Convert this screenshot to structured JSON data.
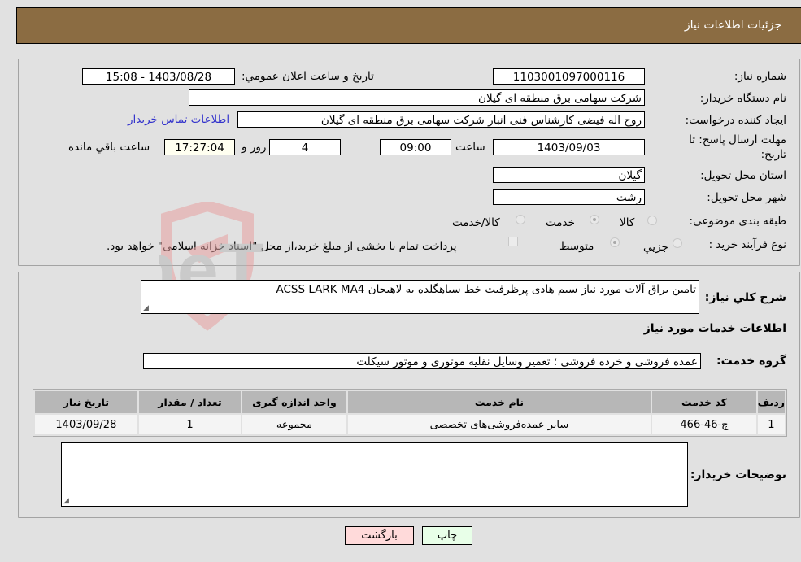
{
  "header": {
    "title": "جزئیات اطلاعات نیاز"
  },
  "form": {
    "need_number_label": "شماره نیاز:",
    "need_number": "1103001097000116",
    "announce_label": "تاریخ و ساعت اعلان عمومي:",
    "announce_value": "1403/08/28 - 15:08",
    "buyer_org_label": "نام دستگاه خریدار:",
    "buyer_org": "شرکت سهامی برق منطقه ای گیلان",
    "creator_label": "ایجاد کننده درخواست:",
    "creator": "روح اله فیضی کارشناس فنی انبار شرکت سهامی برق منطقه ای گیلان",
    "contact_link": "اطلاعات تماس خریدار",
    "deadline_label_1": "مهلت ارسال پاسخ: تا",
    "deadline_label_2": "تاریخ:",
    "deadline_date": "1403/09/03",
    "time_label": "ساعت",
    "deadline_time": "09:00",
    "days_value": "4",
    "days_label": "روز و",
    "remaining_time": "17:27:04",
    "remaining_label": "ساعت باقي مانده",
    "province_label": "استان محل تحویل:",
    "province": "گیلان",
    "city_label": "شهر محل تحویل:",
    "city": "رشت",
    "category_label": "طبقه بندی موضوعی:",
    "category_options": [
      {
        "label": "کالا",
        "checked": false
      },
      {
        "label": "خدمت",
        "checked": true
      },
      {
        "label": "کالا/خدمت",
        "checked": false
      }
    ],
    "process_label": "نوع فرآیند خرید :",
    "process_options": [
      {
        "label": "جزيي",
        "checked": false
      },
      {
        "label": "متوسط",
        "checked": true
      }
    ],
    "treasury_checkbox_checked": false,
    "treasury_text": "پرداخت تمام یا بخشی از مبلغ خرید،از محل \"اسناد خزانه اسلامی\" خواهد بود."
  },
  "details": {
    "summary_label": "شرح كلي نياز:",
    "summary_value": "تامین یراق آلات مورد نیاز سیم هادی پرظرفیت خط سیاهگلده به لاهیجان ACSS LARK MA4",
    "services_heading": "اطلاعات خدمات مورد نیاز",
    "service_group_label": "گروه خدمت:",
    "service_group": "عمده فروشی و خرده فروشی ؛ تعمیر وسایل نقلیه موتوری و موتور سیکلت",
    "table": {
      "headers": [
        "ردیف",
        "کد خدمت",
        "نام خدمت",
        "واحد اندازه گیری",
        "تعداد / مقدار",
        "تاریخ نیاز"
      ],
      "rows": [
        [
          "1",
          "چ-46-466",
          "سایر عمده‌فروشی‌های تخصصی",
          "مجموعه",
          "1",
          "1403/09/28"
        ]
      ]
    },
    "buyer_notes_label": "توضیحات خریدار:",
    "buyer_notes": ""
  },
  "buttons": {
    "print": "چاپ",
    "back": "بازگشت"
  },
  "watermark": {
    "text": "AriaTender.neT"
  },
  "colors": {
    "header_bg": "#8b6c42",
    "link": "#3333cc",
    "back_btn": "#ffdada",
    "print_btn": "#e8ffe8"
  }
}
